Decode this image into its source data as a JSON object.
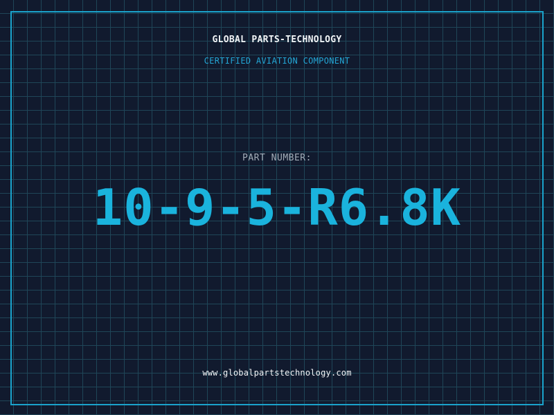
{
  "header": {
    "brand": "GLOBAL PARTS-TECHNOLOGY",
    "tagline": "CERTIFIED AVIATION COMPONENT"
  },
  "part": {
    "label": "PART NUMBER:",
    "number": "10-9-5-R6.8K"
  },
  "footer": {
    "url": "www.globalpartstechnology.com"
  },
  "colors": {
    "background": "#111a2e",
    "grid": "#1f4658",
    "accent": "#1ab3dd",
    "frame": "#1aa3cc"
  }
}
